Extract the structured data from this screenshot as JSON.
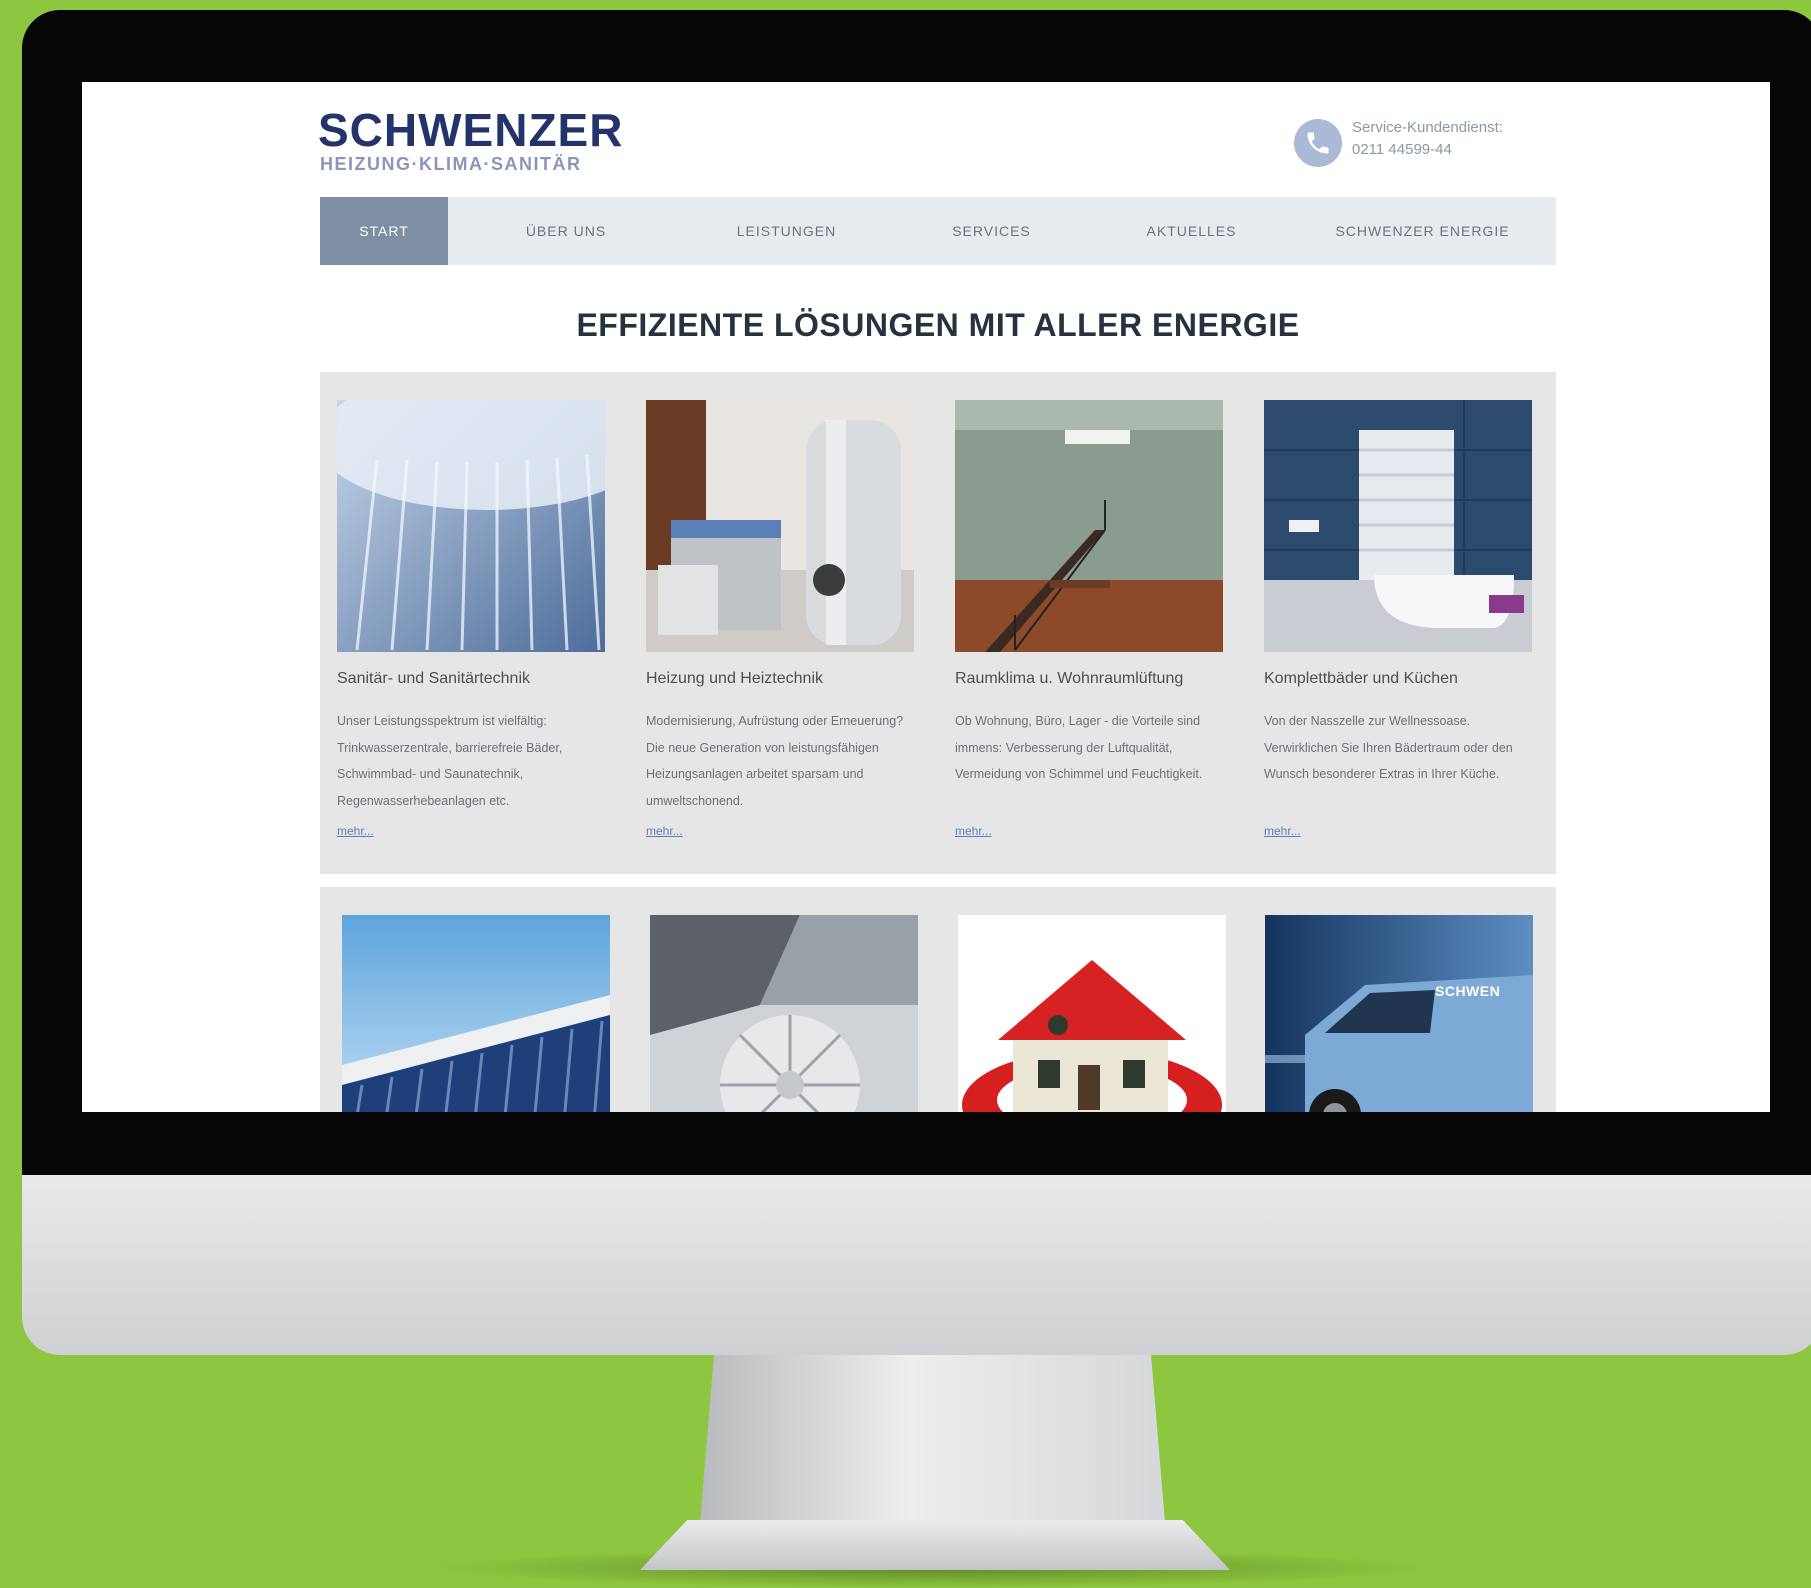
{
  "header": {
    "logo_main": "SCHWENZER",
    "logo_sub": "HEIZUNG·KLIMA·SANITÄR",
    "service_label": "Service-Kundendienst:",
    "service_phone": "0211 44599-44"
  },
  "nav": {
    "items": [
      {
        "label": "START",
        "active": true
      },
      {
        "label": "ÜBER UNS"
      },
      {
        "label": "LEISTUNGEN"
      },
      {
        "label": "SERVICES"
      },
      {
        "label": "AKTUELLES"
      },
      {
        "label": "SCHWENZER ENERGIE"
      }
    ]
  },
  "main": {
    "headline": "EFFIZIENTE LÖSUNGEN MIT ALLER ENERGIE",
    "cards": [
      {
        "title": "Sanitär- und Sanitärtechnik",
        "text": "Unser Leistungsspektrum ist vielfältig: Trinkwasserzentrale, barrierefreie Bäder, Schwimmbad- und Saunatechnik, Regenwasserhebeanlagen etc.",
        "more": "mehr..."
      },
      {
        "title": "Heizung und Heiztechnik",
        "text": "Modernisierung, Aufrüstung oder Erneuerung? Die neue Generation von leistungsfähigen Heizungsanlagen arbeitet sparsam und umweltschonend.",
        "more": "mehr..."
      },
      {
        "title": "Raumklima u. Wohnraumlüftung",
        "text": "Ob Wohnung, Büro, Lager - die Vorteile sind immens: Verbesserung der Luftqualität, Vermeidung von Schimmel und Feuchtigkeit.",
        "more": "mehr..."
      },
      {
        "title": "Komplettbäder und Küchen",
        "text": "Von der Nasszelle zur Wellnessoase. Verwirklichen Sie Ihren Bädertraum oder den Wunsch besonderer Extras in Ihrer Küche.",
        "more": "mehr..."
      }
    ],
    "van_lettering": "SCHWEN"
  }
}
